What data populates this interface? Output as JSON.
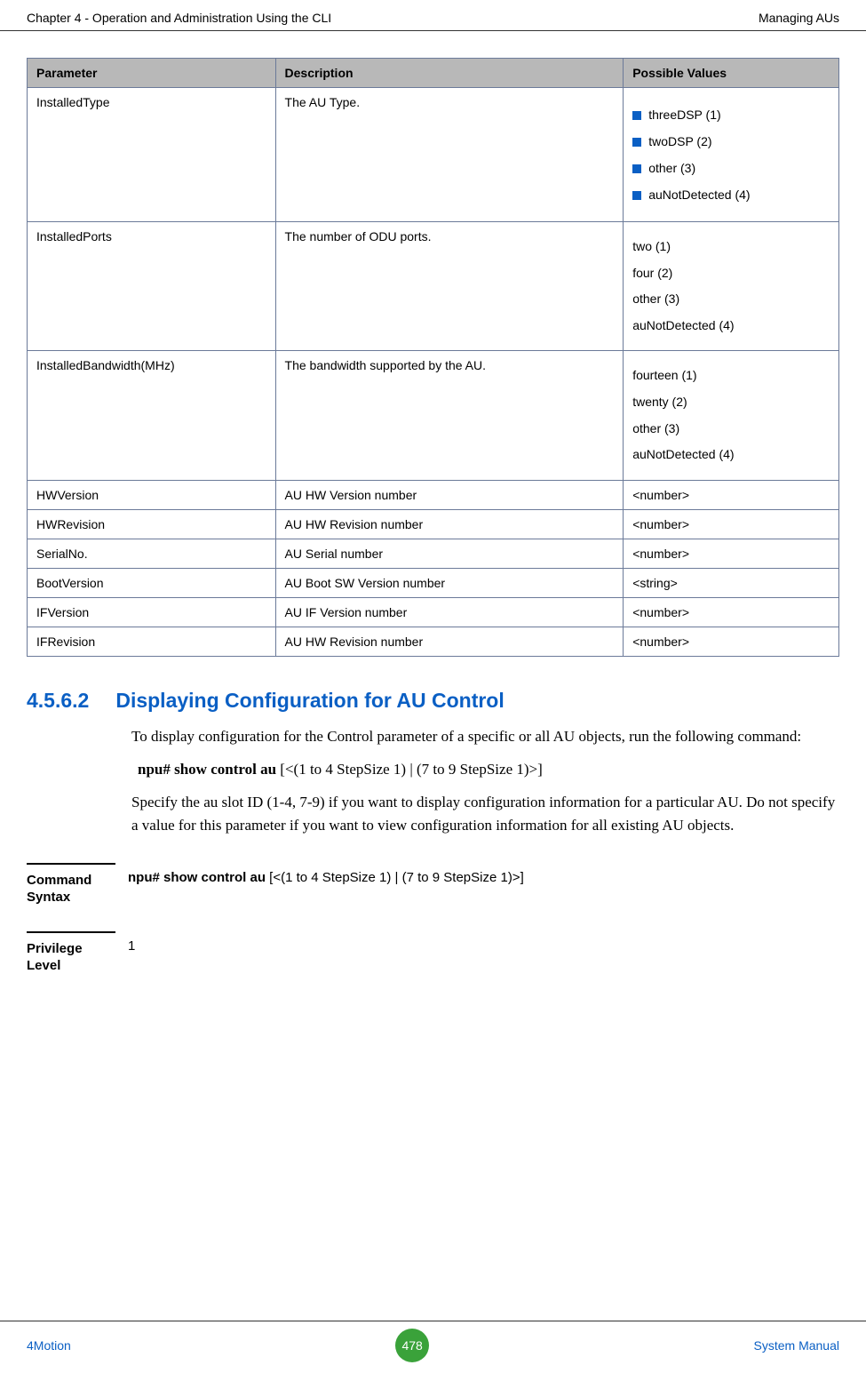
{
  "header": {
    "left": "Chapter 4 - Operation and Administration Using the CLI",
    "right": "Managing AUs"
  },
  "table": {
    "headers": [
      "Parameter",
      "Description",
      "Possible Values"
    ],
    "rows": [
      {
        "param": "InstalledType",
        "desc": "The AU Type.",
        "values_bulleted": [
          "threeDSP (1)",
          "twoDSP (2)",
          "other (3)",
          "auNotDetected (4)"
        ]
      },
      {
        "param": "InstalledPorts",
        "desc": "The number of ODU ports.",
        "values_plain": [
          "two (1)",
          "four (2)",
          "other (3)",
          "auNotDetected (4)"
        ]
      },
      {
        "param": "InstalledBandwidth(MHz)",
        "desc": "The bandwidth supported by the AU.",
        "values_plain": [
          "fourteen (1)",
          "twenty (2)",
          "other (3)",
          "auNotDetected (4)"
        ]
      },
      {
        "param": "HWVersion",
        "desc": "AU HW Version number",
        "value": "<number>"
      },
      {
        "param": "HWRevision",
        "desc": "AU HW Revision number",
        "value": "<number>"
      },
      {
        "param": "SerialNo.",
        "desc": "AU Serial number",
        "value": "<number>"
      },
      {
        "param": "BootVersion",
        "desc": "AU Boot SW Version number",
        "value": "<string>"
      },
      {
        "param": "IFVersion",
        "desc": "AU IF Version number",
        "value": "<number>"
      },
      {
        "param": "IFRevision",
        "desc": "AU HW Revision number",
        "value": "<number>"
      }
    ]
  },
  "section": {
    "number": "4.5.6.2",
    "title": "Displaying Configuration for AU Control",
    "para1": "To display configuration for the Control parameter of a specific or all AU objects, run the following command:",
    "command_bold": "npu# show control au",
    "command_rest": " [<(1 to 4 StepSize 1) | (7 to 9 StepSize 1)>]",
    "para2": "Specify the au slot ID (1-4, 7-9) if you want to display configuration information for a particular AU. Do not specify a value for this parameter if you want to view configuration information for all existing AU objects."
  },
  "cmdbox1": {
    "label1": "Command",
    "label2": "Syntax",
    "text_bold": "npu# show control au",
    "text_rest": " [<(1 to 4 StepSize 1) | (7 to 9 StepSize 1)>]"
  },
  "cmdbox2": {
    "label1": "Privilege",
    "label2": "Level",
    "text": "1"
  },
  "footer": {
    "left": "4Motion",
    "page": "478",
    "right": "System Manual"
  }
}
